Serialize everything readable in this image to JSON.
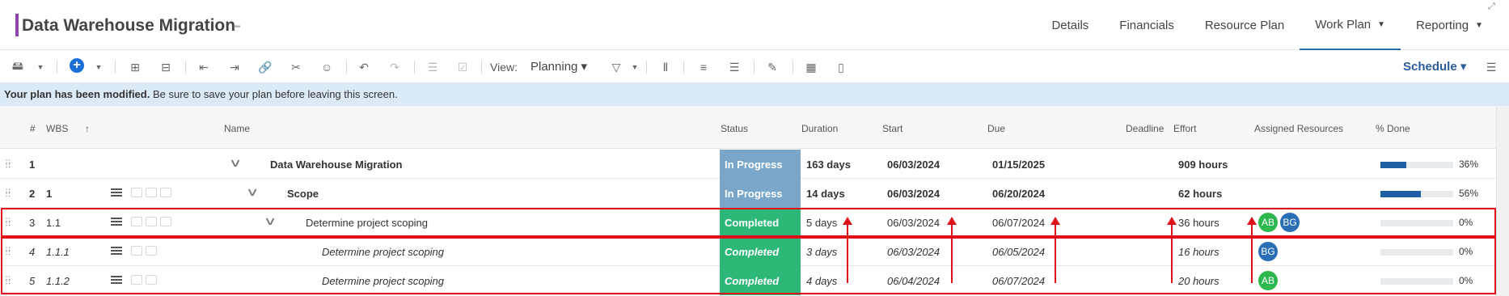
{
  "header": {
    "title": "Data Warehouse Migration",
    "title_menu": "•••",
    "nav": [
      {
        "label": "Details"
      },
      {
        "label": "Financials"
      },
      {
        "label": "Resource Plan"
      },
      {
        "label": "Work Plan",
        "active": true,
        "caret": "▼"
      },
      {
        "label": "Reporting",
        "caret": "▼"
      }
    ],
    "accent_color": "#8e44ad"
  },
  "toolbar": {
    "view_label": "View:",
    "view_value": "Planning ▾",
    "schedule_label": "Schedule ▾",
    "icons": [
      "save-icon",
      "add-icon",
      "expand-icon",
      "collapse-icon",
      "outdent-icon",
      "indent-icon",
      "link-icon",
      "unlink-icon",
      "assign-icon",
      "undo-icon",
      "redo-icon",
      "baseline-icon",
      "check-icon",
      "filter-icon",
      "columns-icon",
      "align-icon",
      "hierarchy-icon",
      "paint-icon",
      "calendar-icon",
      "clipboard-icon",
      "menu-icon"
    ]
  },
  "banner": {
    "bold": "Your plan has been modified.",
    "text": " Be sure to save your plan before leaving this screen."
  },
  "columns": {
    "num": "#",
    "wbs": "WBS",
    "sort": "↑",
    "name": "Name",
    "status": "Status",
    "duration": "Duration",
    "start": "Start",
    "due": "Due",
    "deadline": "Deadline",
    "effort": "Effort",
    "resources": "Assigned Resources",
    "done": "% Done"
  },
  "rows": [
    {
      "num": "1",
      "wbs": "",
      "name": "Data Warehouse Migration",
      "status": "In Progress",
      "duration": "163 days",
      "start": "06/03/2024",
      "due": "01/15/2025",
      "effort": "909 hours",
      "pct": "36%",
      "progress": 0.36
    },
    {
      "num": "2",
      "wbs": "1",
      "name": "Scope",
      "status": "In Progress",
      "duration": "14 days",
      "start": "06/03/2024",
      "due": "06/20/2024",
      "effort": "62 hours",
      "pct": "56%",
      "progress": 0.56
    },
    {
      "num": "3",
      "wbs": "1.1",
      "name": "Determine project scoping",
      "status": "Completed",
      "duration": "5 days",
      "start": "06/03/2024",
      "due": "06/07/2024",
      "effort": "36 hours",
      "pct": "0%",
      "progress": 0,
      "avatars": [
        "AB",
        "BG"
      ]
    },
    {
      "num": "4",
      "wbs": "1.1.1",
      "name": "Determine project scoping",
      "status": "Completed",
      "duration": "3 days",
      "start": "06/03/2024",
      "due": "06/05/2024",
      "effort": "16 hours",
      "pct": "0%",
      "progress": 0,
      "avatars": [
        "BG"
      ]
    },
    {
      "num": "5",
      "wbs": "1.1.2",
      "name": "Determine project scoping",
      "status": "Completed",
      "duration": "4 days",
      "start": "06/04/2024",
      "due": "06/07/2024",
      "effort": "20 hours",
      "pct": "0%",
      "progress": 0,
      "avatars": [
        "AB"
      ]
    }
  ],
  "colors": {
    "in_progress": "#7aa7c9",
    "completed": "#2db87a",
    "progress_fill": "#1f5fa6",
    "annotation": "#e0101a"
  }
}
